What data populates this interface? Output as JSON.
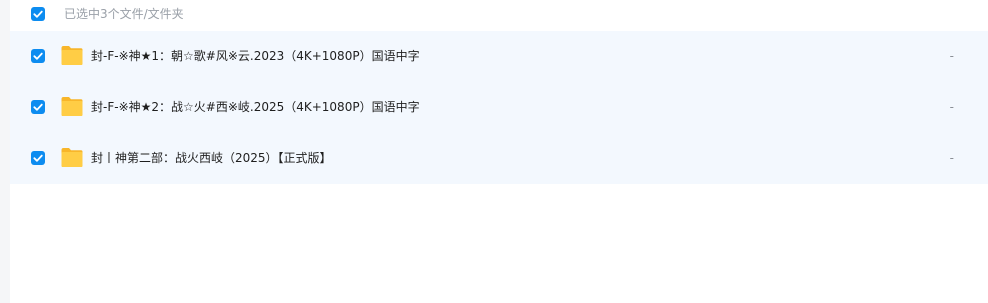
{
  "header": {
    "selected_text": "已选中3个文件/文件夹",
    "select_all_checked": true
  },
  "files": [
    {
      "name": "封-F-※神★1：朝☆歌#风※云.2023（4K+1080P）国语中字",
      "size": "-",
      "checked": true,
      "icon": "folder-icon"
    },
    {
      "name": "封-F-※神★2：战☆火#西※岐.2025（4K+1080P）国语中字",
      "size": "-",
      "checked": true,
      "icon": "folder-icon"
    },
    {
      "name": "封丨神第二部：战火西岐（2025）【正式版】",
      "size": "-",
      "checked": true,
      "icon": "folder-icon"
    }
  ],
  "colors": {
    "accent": "#0d8cf0",
    "row_selected_bg": "#f3f8fe",
    "folder": "#ffc93f"
  }
}
